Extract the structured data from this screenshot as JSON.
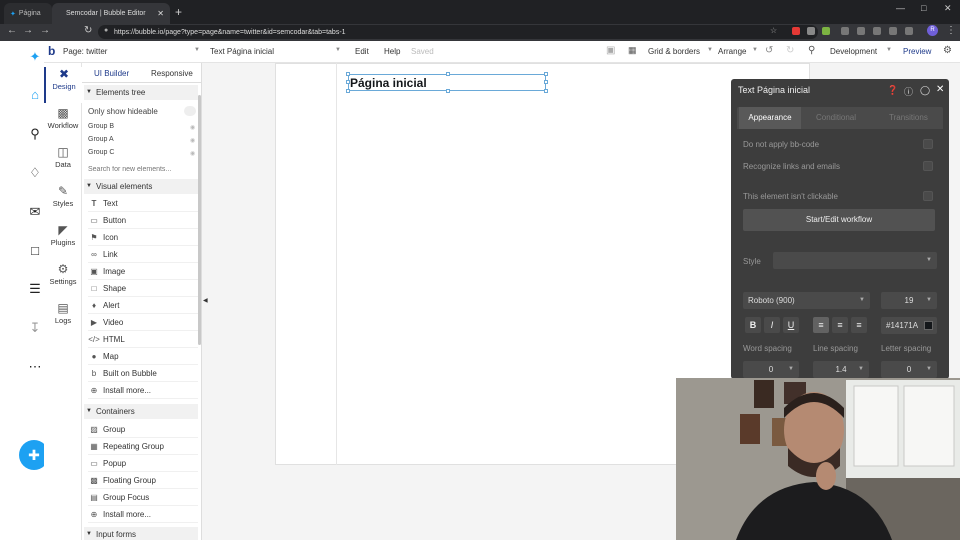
{
  "browser": {
    "tabs": [
      {
        "label": "Página"
      },
      {
        "label": "Semcodar | Bubble Editor"
      }
    ],
    "url": "https://bubble.io/page?type=page&name=twitter&id=semcodar&tab=tabs-1",
    "profile_initial": "R"
  },
  "topbar": {
    "page": "Page: twitter",
    "element": "Text Página inicial",
    "edit": "Edit",
    "help": "Help",
    "saved": "Saved",
    "grid": "Grid & borders",
    "arrange": "Arrange",
    "development": "Development",
    "preview": "Preview"
  },
  "design_tabs": [
    "Design",
    "Workflow",
    "Data",
    "Styles",
    "Plugins",
    "Settings",
    "Logs"
  ],
  "palette": {
    "tab_ui_builder": "UI Builder",
    "tab_responsive": "Responsive",
    "elements_tree": "Elements tree",
    "only_show_hideable": "Only show hideable",
    "tree_items": [
      "Group B",
      "Group A",
      "Group C"
    ],
    "search_placeholder": "Search for new elements...",
    "visual_elements": "Visual elements",
    "visual_items": [
      "Text",
      "Button",
      "Icon",
      "Link",
      "Image",
      "Shape",
      "Alert",
      "Video",
      "HTML",
      "Map",
      "Built on Bubble",
      "Install more..."
    ],
    "containers": "Containers",
    "container_items": [
      "Group",
      "Repeating Group",
      "Popup",
      "Floating Group",
      "Group Focus",
      "Install more..."
    ],
    "input_forms": "Input forms"
  },
  "canvas": {
    "selected_text": "Página inicial"
  },
  "property_editor": {
    "title": "Text Página inicial",
    "tabs": [
      "Appearance",
      "Conditional",
      "Transitions"
    ],
    "do_not_apply_bb": "Do not apply bb-code",
    "recognize_links": "Recognize links and emails",
    "not_clickable": "This element isn't clickable",
    "workflow_button": "Start/Edit workflow",
    "style_label": "Style",
    "font": "Roboto (900)",
    "font_size": "19",
    "color_hex": "#14171A",
    "word_spacing_label": "Word spacing",
    "line_spacing_label": "Line spacing",
    "letter_spacing_label": "Letter spacing",
    "word_spacing": "0",
    "line_spacing": "1.4",
    "letter_spacing": "0"
  },
  "colors": {
    "bubble_blue": "#1e3a8a",
    "twitter_blue": "#1da1f2",
    "panel_dark": "#3d3d3d",
    "text_color": "#14171a"
  }
}
